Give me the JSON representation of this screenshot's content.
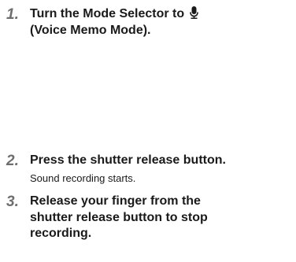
{
  "steps": [
    {
      "number": "1.",
      "title_before_icon": "Turn the Mode Selector to ",
      "icon": "microphone-icon",
      "title_line2": "(Voice Memo Mode)."
    },
    {
      "number": "2.",
      "title": "Press the shutter release button.",
      "desc": "Sound recording starts."
    },
    {
      "number": "3.",
      "title_lines": [
        "Release your finger from the",
        "shutter release button to stop",
        "recording."
      ]
    }
  ]
}
